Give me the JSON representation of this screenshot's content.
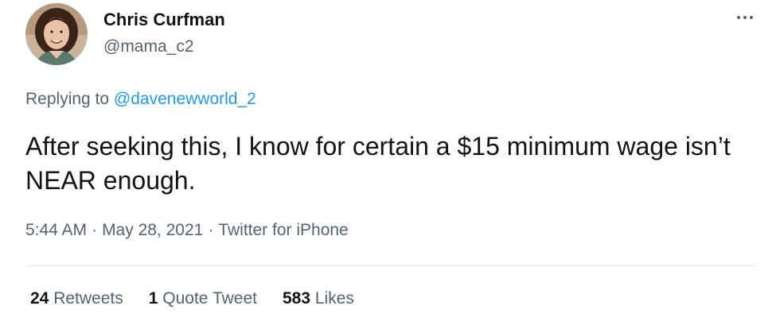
{
  "author": {
    "display_name": "Chris Curfman",
    "handle": "@mama_c2"
  },
  "reply": {
    "prefix": "Replying to",
    "mention": "@davenewworld_2"
  },
  "tweet": {
    "text": "After seeking this, I know for certain a $15 minimum wage isn’t NEAR enough."
  },
  "meta": {
    "time": "5:44 AM",
    "separator": "·",
    "date": "May 28, 2021",
    "source": "Twitter for iPhone"
  },
  "stats": {
    "retweets_count": "24",
    "retweets_label": "Retweets",
    "quotes_count": "1",
    "quotes_label": "Quote Tweet",
    "likes_count": "583",
    "likes_label": "Likes"
  },
  "icons": {
    "more": "more-horizontal-icon",
    "avatar": "profile-photo"
  },
  "colors": {
    "text_primary": "#0f1419",
    "text_secondary": "#536471",
    "link": "#1d9bf0",
    "divider": "#e6ecf0"
  }
}
